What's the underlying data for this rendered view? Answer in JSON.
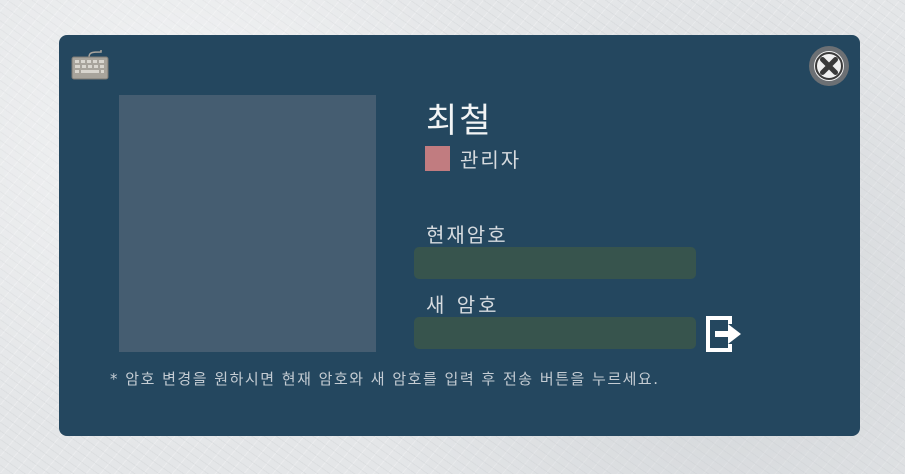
{
  "profile": {
    "name": "최철",
    "role": "관리자",
    "role_color": "#c17c80"
  },
  "form": {
    "current_password_label": "현재암호",
    "new_password_label": "새 암호",
    "current_password_value": "",
    "new_password_value": ""
  },
  "hint": "* 암호 변경을 원하시면 현재 암호와 새 암호를 입력 후 전송 버튼을 누르세요.",
  "icons": {
    "keyboard": "keyboard-icon",
    "close": "close-icon",
    "submit": "submit-arrow-icon"
  },
  "colors": {
    "dialog_bg": "#24475f",
    "input_bg": "#37544d",
    "avatar_bg": "#455d71"
  }
}
